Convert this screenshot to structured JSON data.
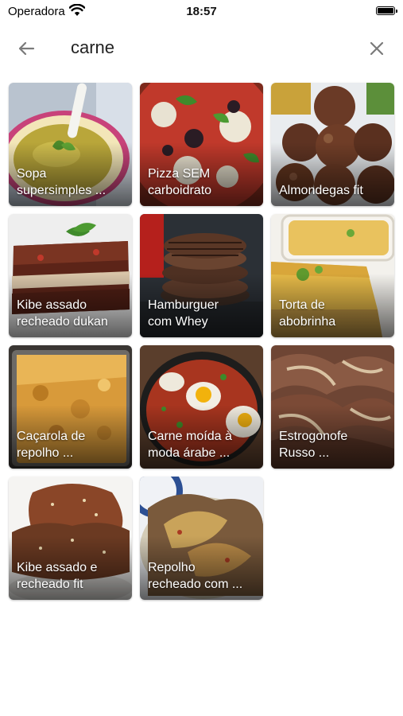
{
  "status": {
    "carrier": "Operadora",
    "time": "18:57"
  },
  "search": {
    "query": "carne"
  },
  "results": [
    {
      "title": "Sopa\nsupersimples ..."
    },
    {
      "title": "Pizza SEM\ncarboidrato"
    },
    {
      "title": "Almondegas fit"
    },
    {
      "title": "Kibe assado\nrecheado dukan"
    },
    {
      "title": "Hamburguer\ncom Whey"
    },
    {
      "title": "Torta de\nabobrinha"
    },
    {
      "title": "Caçarola de\nrepolho ..."
    },
    {
      "title": "Carne moída à\nmoda árabe ..."
    },
    {
      "title": "Estrogonofe\nRusso ..."
    },
    {
      "title": "Kibe assado e\nrecheado fit"
    },
    {
      "title": "Repolho\nrecheado com ..."
    }
  ]
}
